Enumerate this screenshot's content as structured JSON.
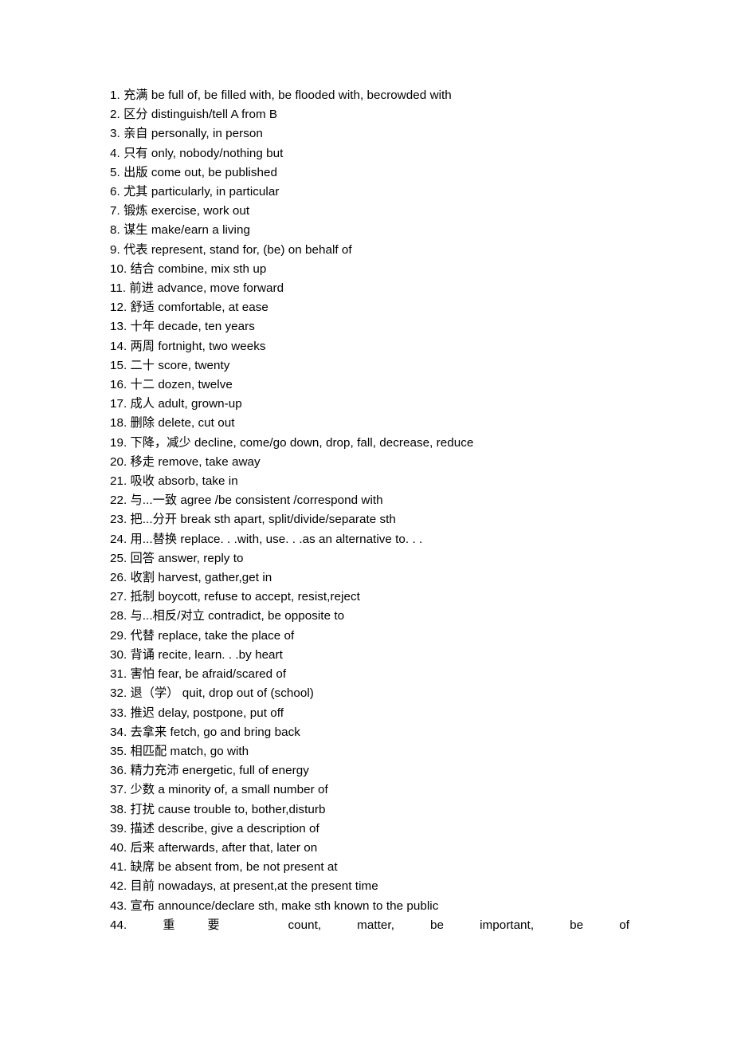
{
  "document": {
    "background_color": "#ffffff",
    "text_color": "#000000",
    "items": [
      {
        "num": "1.",
        "term": "充满",
        "gloss": "be full of, be filled with, be flooded with, becrowded with"
      },
      {
        "num": "2.",
        "term": "区分",
        "gloss": "distinguish/tell A from B"
      },
      {
        "num": "3.",
        "term": "亲自",
        "gloss": "personally, in person"
      },
      {
        "num": "4.",
        "term": "只有",
        "gloss": "only, nobody/nothing but"
      },
      {
        "num": "5.",
        "term": "出版",
        "gloss": "come out, be published"
      },
      {
        "num": "6.",
        "term": "尤其",
        "gloss": "particularly, in particular"
      },
      {
        "num": "7.",
        "term": "锻炼",
        "gloss": "exercise, work out"
      },
      {
        "num": "8.",
        "term": "谋生",
        "gloss": "make/earn a living"
      },
      {
        "num": "9.",
        "term": "代表",
        "gloss": "represent, stand for, (be) on behalf of"
      },
      {
        "num": "10.",
        "term": "结合",
        "gloss": "combine, mix sth up"
      },
      {
        "num": "11.",
        "term": "前进",
        "gloss": "advance, move forward"
      },
      {
        "num": "12.",
        "term": "舒适",
        "gloss": "comfortable, at ease"
      },
      {
        "num": "13.",
        "term": "十年",
        "gloss": "decade, ten years"
      },
      {
        "num": "14.",
        "term": "两周",
        "gloss": "fortnight, two weeks"
      },
      {
        "num": "15.",
        "term": "二十",
        "gloss": "score, twenty"
      },
      {
        "num": "16.",
        "term": "十二",
        "gloss": "dozen, twelve"
      },
      {
        "num": "17.",
        "term": "成人",
        "gloss": "adult, grown-up"
      },
      {
        "num": "18.",
        "term": "删除",
        "gloss": "delete, cut out"
      },
      {
        "num": "19.",
        "term": "下降，减少",
        "gloss": "decline, come/go down, drop, fall, decrease, reduce"
      },
      {
        "num": "20.",
        "term": "移走",
        "gloss": "remove, take away"
      },
      {
        "num": "21.",
        "term": "吸收",
        "gloss": "absorb, take in"
      },
      {
        "num": "22.",
        "term": "与...一致",
        "gloss": "agree /be consistent /correspond with"
      },
      {
        "num": "23.",
        "term": "把...分开",
        "gloss": "break sth apart, split/divide/separate sth"
      },
      {
        "num": "24.",
        "term": "用...替换",
        "gloss": "replace. . .with, use. . .as an alternative to. . ."
      },
      {
        "num": "25.",
        "term": "回答",
        "gloss": "answer, reply to"
      },
      {
        "num": "26.",
        "term": "收割",
        "gloss": "harvest, gather,get in"
      },
      {
        "num": "27.",
        "term": "抵制",
        "gloss": "boycott, refuse to accept, resist,reject"
      },
      {
        "num": "28.",
        "term": "与...相反/对立",
        "gloss": "contradict, be opposite to"
      },
      {
        "num": "29.",
        "term": "代替",
        "gloss": "replace, take the place of"
      },
      {
        "num": "30.",
        "term": "背诵",
        "gloss": "recite, learn. . .by heart"
      },
      {
        "num": "31.",
        "term": "害怕",
        "gloss": "fear, be afraid/scared of"
      },
      {
        "num": "32.",
        "term": "退（学）",
        "gloss": "quit, drop out of (school)"
      },
      {
        "num": "33.",
        "term": "推迟",
        "gloss": "delay, postpone, put off"
      },
      {
        "num": "34.",
        "term": "去拿来",
        "gloss": "fetch, go and bring back"
      },
      {
        "num": "35.",
        "term": "相匹配",
        "gloss": "match, go with"
      },
      {
        "num": "36.",
        "term": "精力充沛",
        "gloss": "energetic, full of energy"
      },
      {
        "num": "37.",
        "term": "少数",
        "gloss": "a minority of, a small number of"
      },
      {
        "num": "38.",
        "term": "打扰",
        "gloss": "cause trouble to, bother,disturb"
      },
      {
        "num": "39.",
        "term": "描述",
        "gloss": "describe, give a description of"
      },
      {
        "num": "40.",
        "term": "后来",
        "gloss": "afterwards, after that, later on"
      },
      {
        "num": "41.",
        "term": "缺席",
        "gloss": "be absent from, be not present at"
      },
      {
        "num": "42.",
        "term": "目前",
        "gloss": "nowadays, at present,at the present time"
      },
      {
        "num": "43.",
        "term": "宣布",
        "gloss": "announce/declare sth, make sth known to the public"
      },
      {
        "num": "44.",
        "term": "重要",
        "gloss": "count, matter, be important, be of"
      }
    ]
  }
}
